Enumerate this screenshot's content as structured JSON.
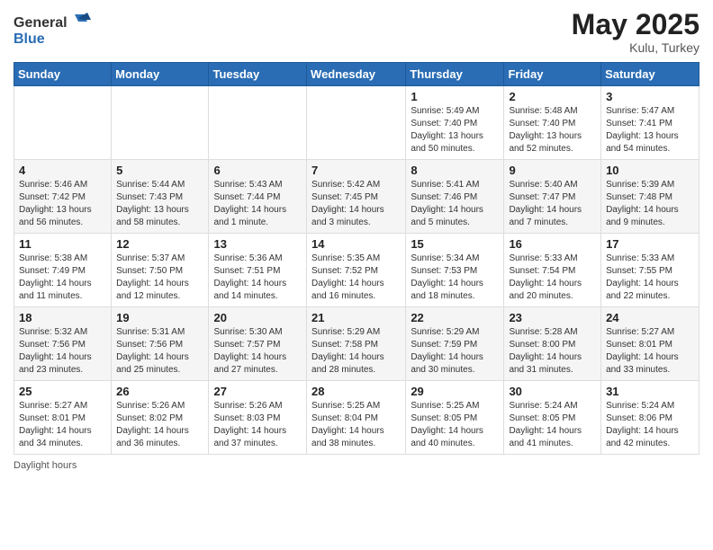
{
  "header": {
    "logo_general": "General",
    "logo_blue": "Blue",
    "month_title": "May 2025",
    "subtitle": "Kulu, Turkey"
  },
  "weekdays": [
    "Sunday",
    "Monday",
    "Tuesday",
    "Wednesday",
    "Thursday",
    "Friday",
    "Saturday"
  ],
  "weeks": [
    [
      {
        "day": "",
        "info": ""
      },
      {
        "day": "",
        "info": ""
      },
      {
        "day": "",
        "info": ""
      },
      {
        "day": "",
        "info": ""
      },
      {
        "day": "1",
        "info": "Sunrise: 5:49 AM\nSunset: 7:40 PM\nDaylight: 13 hours\nand 50 minutes."
      },
      {
        "day": "2",
        "info": "Sunrise: 5:48 AM\nSunset: 7:40 PM\nDaylight: 13 hours\nand 52 minutes."
      },
      {
        "day": "3",
        "info": "Sunrise: 5:47 AM\nSunset: 7:41 PM\nDaylight: 13 hours\nand 54 minutes."
      }
    ],
    [
      {
        "day": "4",
        "info": "Sunrise: 5:46 AM\nSunset: 7:42 PM\nDaylight: 13 hours\nand 56 minutes."
      },
      {
        "day": "5",
        "info": "Sunrise: 5:44 AM\nSunset: 7:43 PM\nDaylight: 13 hours\nand 58 minutes."
      },
      {
        "day": "6",
        "info": "Sunrise: 5:43 AM\nSunset: 7:44 PM\nDaylight: 14 hours\nand 1 minute."
      },
      {
        "day": "7",
        "info": "Sunrise: 5:42 AM\nSunset: 7:45 PM\nDaylight: 14 hours\nand 3 minutes."
      },
      {
        "day": "8",
        "info": "Sunrise: 5:41 AM\nSunset: 7:46 PM\nDaylight: 14 hours\nand 5 minutes."
      },
      {
        "day": "9",
        "info": "Sunrise: 5:40 AM\nSunset: 7:47 PM\nDaylight: 14 hours\nand 7 minutes."
      },
      {
        "day": "10",
        "info": "Sunrise: 5:39 AM\nSunset: 7:48 PM\nDaylight: 14 hours\nand 9 minutes."
      }
    ],
    [
      {
        "day": "11",
        "info": "Sunrise: 5:38 AM\nSunset: 7:49 PM\nDaylight: 14 hours\nand 11 minutes."
      },
      {
        "day": "12",
        "info": "Sunrise: 5:37 AM\nSunset: 7:50 PM\nDaylight: 14 hours\nand 12 minutes."
      },
      {
        "day": "13",
        "info": "Sunrise: 5:36 AM\nSunset: 7:51 PM\nDaylight: 14 hours\nand 14 minutes."
      },
      {
        "day": "14",
        "info": "Sunrise: 5:35 AM\nSunset: 7:52 PM\nDaylight: 14 hours\nand 16 minutes."
      },
      {
        "day": "15",
        "info": "Sunrise: 5:34 AM\nSunset: 7:53 PM\nDaylight: 14 hours\nand 18 minutes."
      },
      {
        "day": "16",
        "info": "Sunrise: 5:33 AM\nSunset: 7:54 PM\nDaylight: 14 hours\nand 20 minutes."
      },
      {
        "day": "17",
        "info": "Sunrise: 5:33 AM\nSunset: 7:55 PM\nDaylight: 14 hours\nand 22 minutes."
      }
    ],
    [
      {
        "day": "18",
        "info": "Sunrise: 5:32 AM\nSunset: 7:56 PM\nDaylight: 14 hours\nand 23 minutes."
      },
      {
        "day": "19",
        "info": "Sunrise: 5:31 AM\nSunset: 7:56 PM\nDaylight: 14 hours\nand 25 minutes."
      },
      {
        "day": "20",
        "info": "Sunrise: 5:30 AM\nSunset: 7:57 PM\nDaylight: 14 hours\nand 27 minutes."
      },
      {
        "day": "21",
        "info": "Sunrise: 5:29 AM\nSunset: 7:58 PM\nDaylight: 14 hours\nand 28 minutes."
      },
      {
        "day": "22",
        "info": "Sunrise: 5:29 AM\nSunset: 7:59 PM\nDaylight: 14 hours\nand 30 minutes."
      },
      {
        "day": "23",
        "info": "Sunrise: 5:28 AM\nSunset: 8:00 PM\nDaylight: 14 hours\nand 31 minutes."
      },
      {
        "day": "24",
        "info": "Sunrise: 5:27 AM\nSunset: 8:01 PM\nDaylight: 14 hours\nand 33 minutes."
      }
    ],
    [
      {
        "day": "25",
        "info": "Sunrise: 5:27 AM\nSunset: 8:01 PM\nDaylight: 14 hours\nand 34 minutes."
      },
      {
        "day": "26",
        "info": "Sunrise: 5:26 AM\nSunset: 8:02 PM\nDaylight: 14 hours\nand 36 minutes."
      },
      {
        "day": "27",
        "info": "Sunrise: 5:26 AM\nSunset: 8:03 PM\nDaylight: 14 hours\nand 37 minutes."
      },
      {
        "day": "28",
        "info": "Sunrise: 5:25 AM\nSunset: 8:04 PM\nDaylight: 14 hours\nand 38 minutes."
      },
      {
        "day": "29",
        "info": "Sunrise: 5:25 AM\nSunset: 8:05 PM\nDaylight: 14 hours\nand 40 minutes."
      },
      {
        "day": "30",
        "info": "Sunrise: 5:24 AM\nSunset: 8:05 PM\nDaylight: 14 hours\nand 41 minutes."
      },
      {
        "day": "31",
        "info": "Sunrise: 5:24 AM\nSunset: 8:06 PM\nDaylight: 14 hours\nand 42 minutes."
      }
    ]
  ],
  "footer": "Daylight hours"
}
